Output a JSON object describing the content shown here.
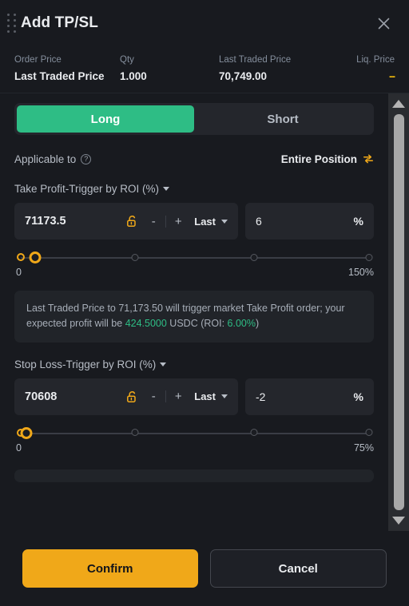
{
  "header": {
    "title": "Add TP/SL",
    "drag_handle": "drag-handle",
    "close_label": "×"
  },
  "summary": [
    {
      "label": "Order Price",
      "value": "Last Traded Price",
      "muted": false
    },
    {
      "label": "Qty",
      "value": "1.000",
      "muted": false
    },
    {
      "label": "Last Traded Price",
      "value": "70,749.00",
      "muted": false
    },
    {
      "label": "Liq. Price",
      "value": "--",
      "muted": true
    }
  ],
  "side_toggle": {
    "long_label": "Long",
    "short_label": "Short",
    "selected": "Long",
    "active_color": "#2EBD85"
  },
  "applicable": {
    "label": "Applicable to",
    "help_icon": "question-circle-icon",
    "value": "Entire Position",
    "swap_icon": "swap-icon"
  },
  "take_profit": {
    "section_label": "Take Profit-Trigger by ROI (%)",
    "price_value": "71173.5",
    "lock_icon": "unlock-icon",
    "minus_label": "-",
    "plus_label": "+",
    "unit_value": "Last",
    "pct_value": "6",
    "pct_unit": "%",
    "slider": {
      "min_label": "0",
      "max_label": "150%",
      "handle_percent": 4,
      "ticks": [
        0,
        33.3,
        66.6,
        100
      ]
    },
    "info": {
      "pre": "Last Traded Price to 71,173.50 will trigger market Take Profit order; your expected profit will be ",
      "profit": "424.5000",
      "mid": " USDC (ROI: ",
      "roi": "6.00%",
      "post": ")"
    }
  },
  "stop_loss": {
    "section_label": "Stop Loss-Trigger by ROI (%)",
    "price_value": "70608",
    "lock_icon": "unlock-icon",
    "minus_label": "-",
    "plus_label": "+",
    "unit_value": "Last",
    "pct_value": "-2",
    "pct_unit": "%",
    "slider": {
      "min_label": "0",
      "max_label": "75%",
      "handle_percent": 1.5,
      "ticks": [
        0,
        33.3,
        66.6,
        100
      ]
    }
  },
  "footer": {
    "confirm_label": "Confirm",
    "cancel_label": "Cancel"
  },
  "scrollbar": {
    "up_icon": "chevron-up-icon",
    "down_icon": "chevron-down-icon"
  },
  "colors": {
    "accent": "#F0A819",
    "long": "#2EBD85",
    "panel": "#181A1F",
    "field": "#24262C"
  }
}
